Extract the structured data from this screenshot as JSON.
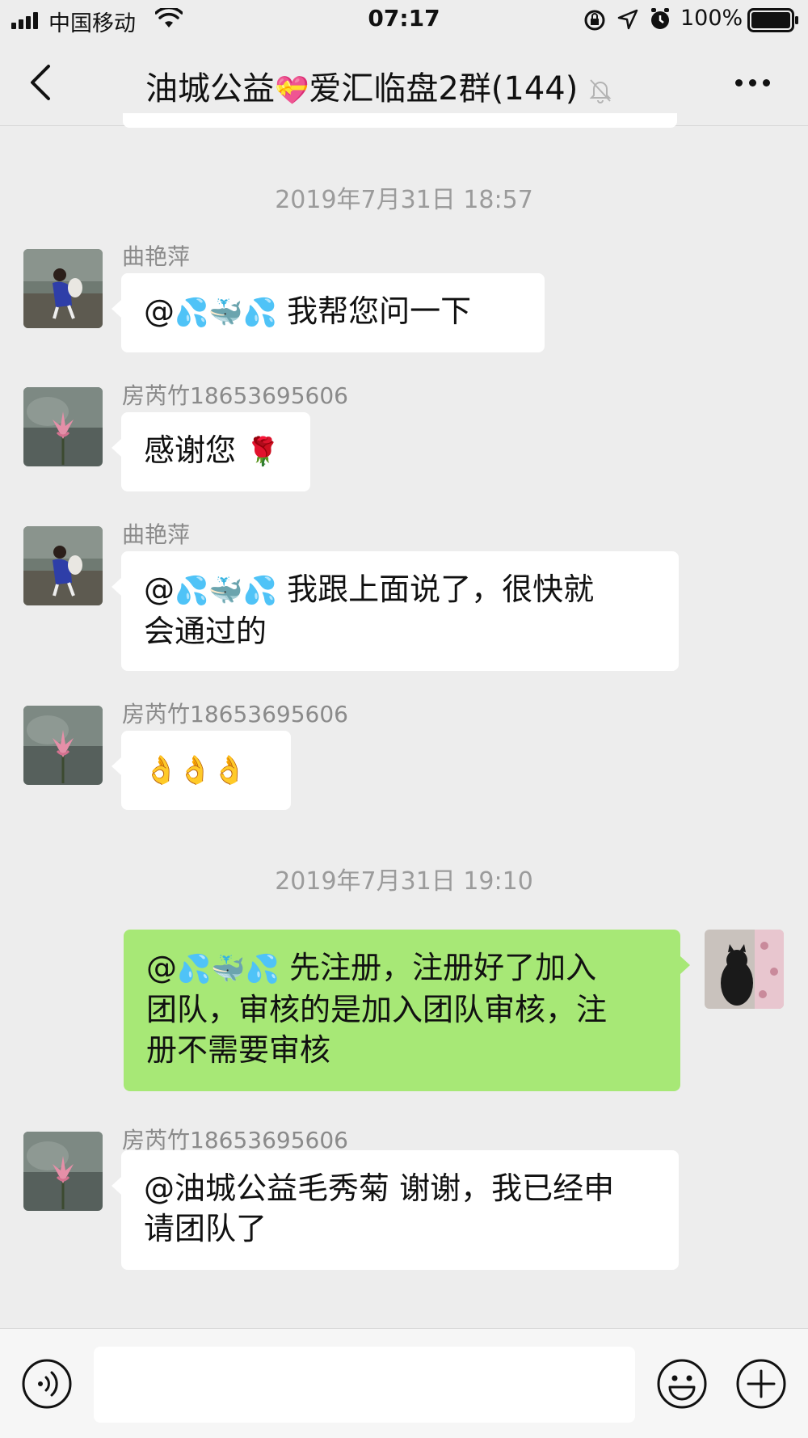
{
  "status_bar": {
    "carrier": "中国移动",
    "time": "07:17",
    "battery": "100%"
  },
  "header": {
    "title_prefix": "油城公益",
    "title_suffix": "爱汇临盘2群(144)"
  },
  "timestamps": [
    "2019年7月31日 18:57",
    "2019年7月31日 19:10"
  ],
  "messages": [
    {
      "sender": "曲艳萍",
      "text": "我帮您问一下"
    },
    {
      "sender": "房芮竹18653695606",
      "text": "感谢您"
    },
    {
      "sender": "曲艳萍",
      "line1": "我跟上面说了，很快就",
      "line2": "会通过的"
    },
    {
      "sender": "房芮竹18653695606",
      "text": ""
    },
    {
      "sender": "",
      "line1": "先注册，注册好了加入",
      "line2": "团队，审核的是加入团队审核，注",
      "line3": "册不需要审核"
    },
    {
      "sender": "房芮竹18653695606",
      "line1": "@油城公益毛秀菊 谢谢，我已经申",
      "line2": "请团队了"
    }
  ],
  "colors": {
    "background": "#ededed",
    "bubble_self": "#a7e876",
    "bubble_other": "#ffffff",
    "meta_text": "#9b9b9b"
  },
  "icons": {
    "back": "chevron-left-icon",
    "more": "more-dots-icon",
    "mute": "bell-off-icon",
    "voice": "voice-icon",
    "emoji": "smiley-icon",
    "add": "plus-icon"
  }
}
